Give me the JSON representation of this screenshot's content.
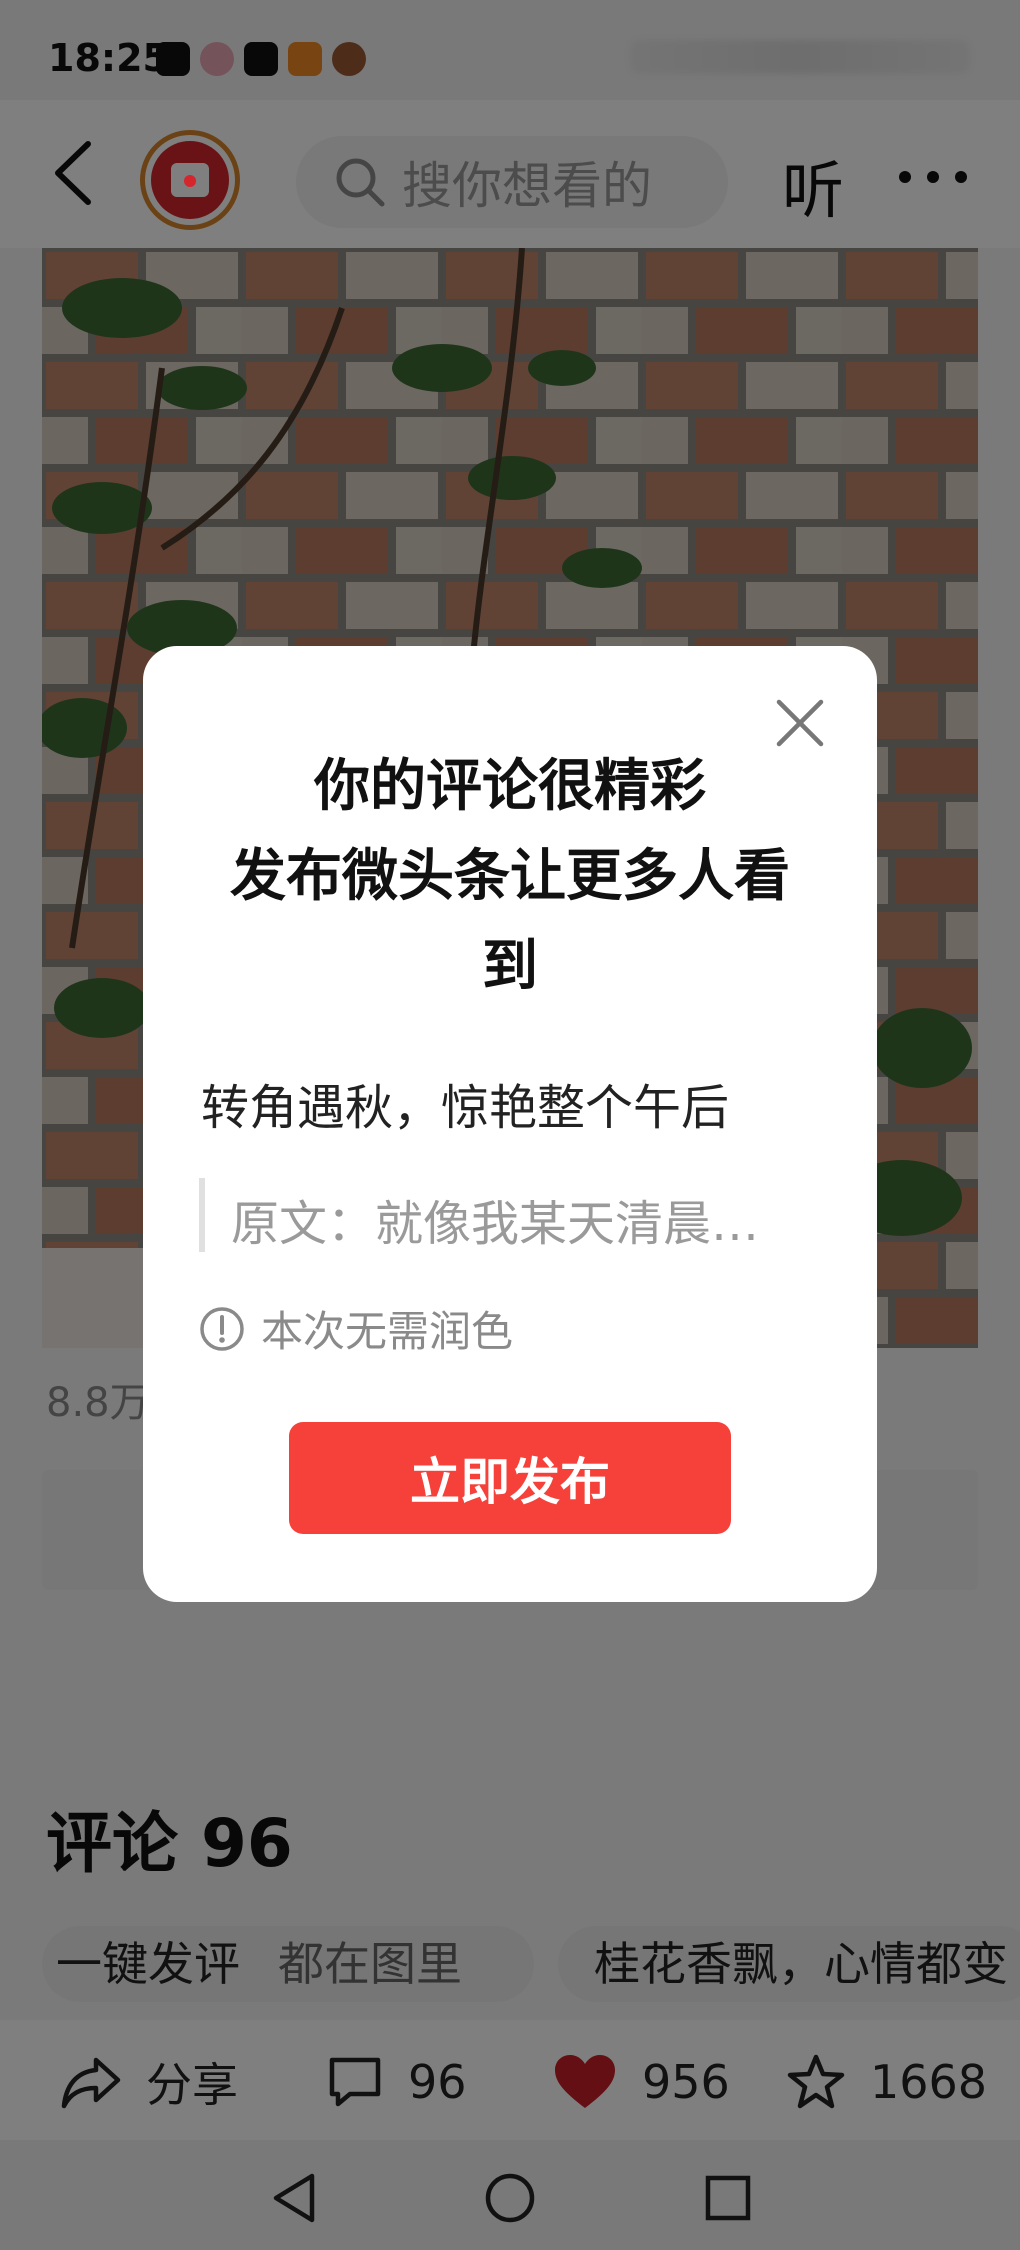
{
  "status_bar": {
    "time": "18:25",
    "notification_icons": [
      "douyin-icon",
      "avatar-app-icon",
      "douyin-live-icon",
      "orange-app-icon",
      "game-app-icon"
    ]
  },
  "header": {
    "search_placeholder": "搜你想看的",
    "listen_label": "听"
  },
  "article": {
    "views": "8.8万"
  },
  "comments": {
    "title": "评论 96",
    "chips": [
      {
        "label": "一键发评",
        "sub": "都在图里"
      },
      {
        "label": "桂花香飘，心情都变"
      }
    ]
  },
  "actions": {
    "share_label": "分享",
    "comment_count": "96",
    "like_count": "956",
    "favorite_count": "1668"
  },
  "modal": {
    "title_line1": "你的评论很精彩",
    "title_line2": "发布微头条让更多人看到",
    "post_text": "转角遇秋，惊艳整个午后",
    "original_text": "原文：就像我某天清晨…",
    "notice": "本次无需润色",
    "publish_label": "立即发布"
  },
  "colors": {
    "accent_red": "#f5413a",
    "like_red": "#c81f26",
    "avatar_red": "#d4262c",
    "avatar_ring": "#d6842a"
  }
}
